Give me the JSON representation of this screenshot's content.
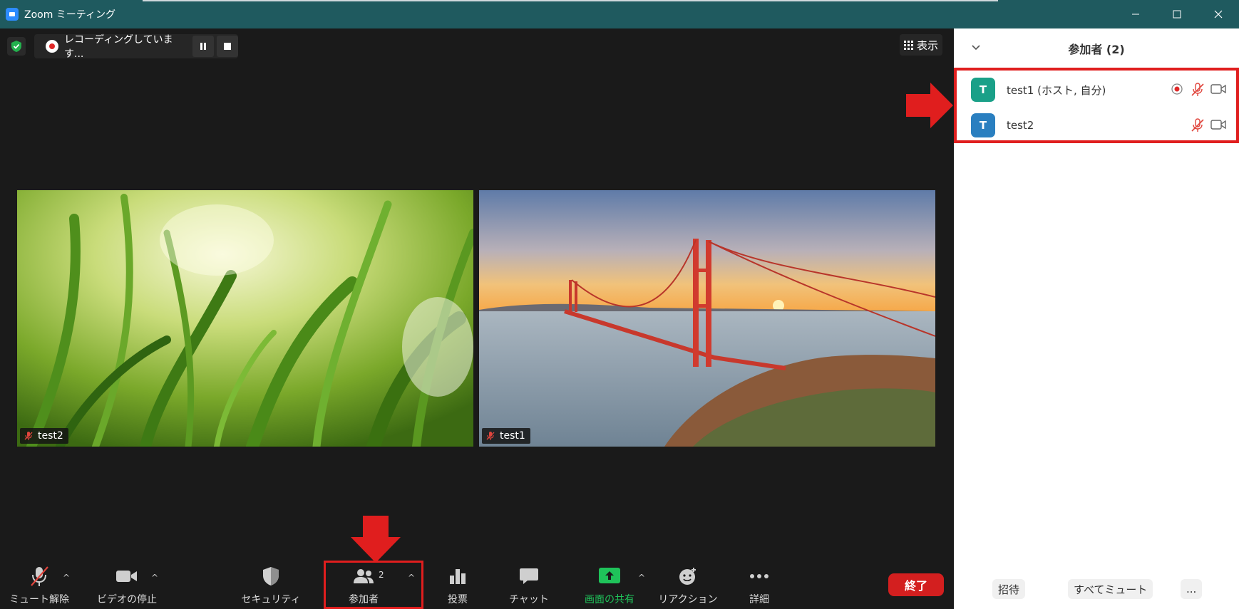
{
  "window": {
    "title": "Zoom ミーティング"
  },
  "recording": {
    "status": "レコーディングしています..."
  },
  "view": {
    "label": "表示"
  },
  "tiles": [
    {
      "name": "test2",
      "muted": true
    },
    {
      "name": "test1",
      "muted": true
    }
  ],
  "toolbar": {
    "unmute": "ミュート解除",
    "stop_video": "ビデオの停止",
    "security": "セキュリティ",
    "participants": "参加者",
    "participants_count": "2",
    "polls": "投票",
    "chat": "チャット",
    "share_screen": "画面の共有",
    "reactions": "リアクション",
    "more": "詳細",
    "end": "終了"
  },
  "panel": {
    "title": "参加者 (2)",
    "participants": [
      {
        "initial": "T",
        "name": "test1 (ホスト, 自分)",
        "avatar_color": "#1aa088",
        "recording": true,
        "muted": true,
        "video_off": true
      },
      {
        "initial": "T",
        "name": "test2",
        "avatar_color": "#2a7fc0",
        "recording": false,
        "muted": true,
        "video_off": true
      }
    ],
    "footer": {
      "invite": "招待",
      "mute_all": "すべてミュート",
      "more": "..."
    }
  },
  "colors": {
    "accent_red": "#e01e1e",
    "share_green": "#1fc35a",
    "titlebar": "#1f5a5f"
  }
}
